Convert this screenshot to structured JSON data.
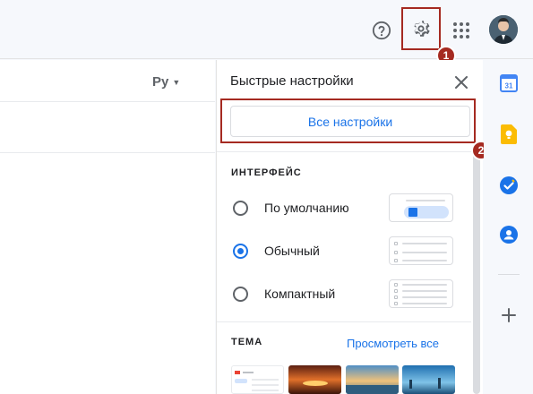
{
  "header": {
    "help_icon": "help-circle-icon",
    "settings_icon": "gear-icon",
    "apps_icon": "apps-grid-icon",
    "avatar": "user-avatar"
  },
  "annotations": {
    "step1": "1",
    "step2": "2",
    "color": "#a52a21"
  },
  "main": {
    "language_select": "Ру"
  },
  "quick_settings": {
    "title": "Быстрые настройки",
    "all_settings_label": "Все настройки",
    "density": {
      "section_label": "ИНТЕРФЕЙС",
      "options": [
        {
          "label": "По умолчанию",
          "selected": false
        },
        {
          "label": "Обычный",
          "selected": true
        },
        {
          "label": "Компактный",
          "selected": false
        }
      ]
    },
    "theme": {
      "section_label": "ТЕМА",
      "view_all": "Просмотреть все"
    }
  },
  "siderail": {
    "calendar_day": "31",
    "items": [
      "calendar-icon",
      "keep-icon",
      "tasks-icon",
      "contacts-icon",
      "add-icon"
    ]
  },
  "colors": {
    "accent": "#1a73e8",
    "highlight": "#a52a21"
  }
}
